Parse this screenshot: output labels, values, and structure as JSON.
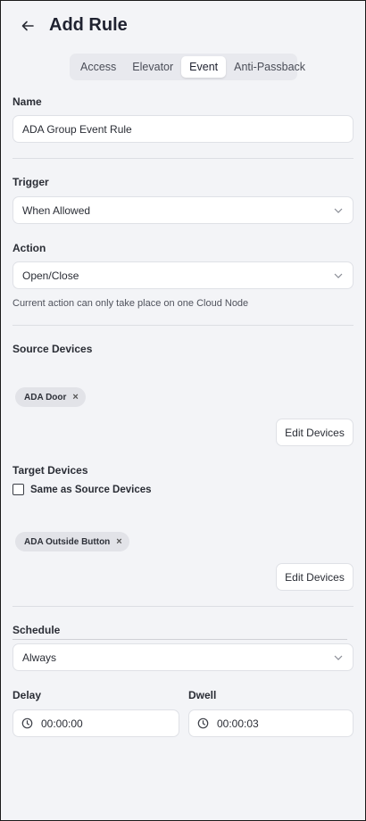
{
  "header": {
    "title": "Add Rule",
    "back_icon": "arrow-left-icon"
  },
  "tabs": [
    {
      "label": "Access",
      "active": false
    },
    {
      "label": "Elevator",
      "active": false
    },
    {
      "label": "Event",
      "active": true
    },
    {
      "label": "Anti-Passback",
      "active": false
    }
  ],
  "name": {
    "label": "Name",
    "value": "ADA Group Event Rule"
  },
  "trigger": {
    "label": "Trigger",
    "value": "When Allowed"
  },
  "action": {
    "label": "Action",
    "value": "Open/Close",
    "helper": "Current action can only take place on one Cloud Node"
  },
  "source_devices": {
    "label": "Source Devices",
    "chips": [
      "ADA Door"
    ],
    "edit_label": "Edit Devices"
  },
  "target_devices": {
    "label": "Target Devices",
    "same_as_source_label": "Same as Source Devices",
    "same_as_source_checked": false,
    "chips": [
      "ADA Outside Button"
    ],
    "edit_label": "Edit Devices"
  },
  "schedule": {
    "label": "Schedule",
    "value": "Always"
  },
  "delay": {
    "label": "Delay",
    "value": "00:00:00",
    "icon": "clock-icon"
  },
  "dwell": {
    "label": "Dwell",
    "value": "00:00:03",
    "icon": "clock-icon"
  },
  "colors": {
    "background": "#f3f4f7",
    "field": "#ffffff",
    "border": "#dfe1e6",
    "chip": "#e2e3e8"
  }
}
